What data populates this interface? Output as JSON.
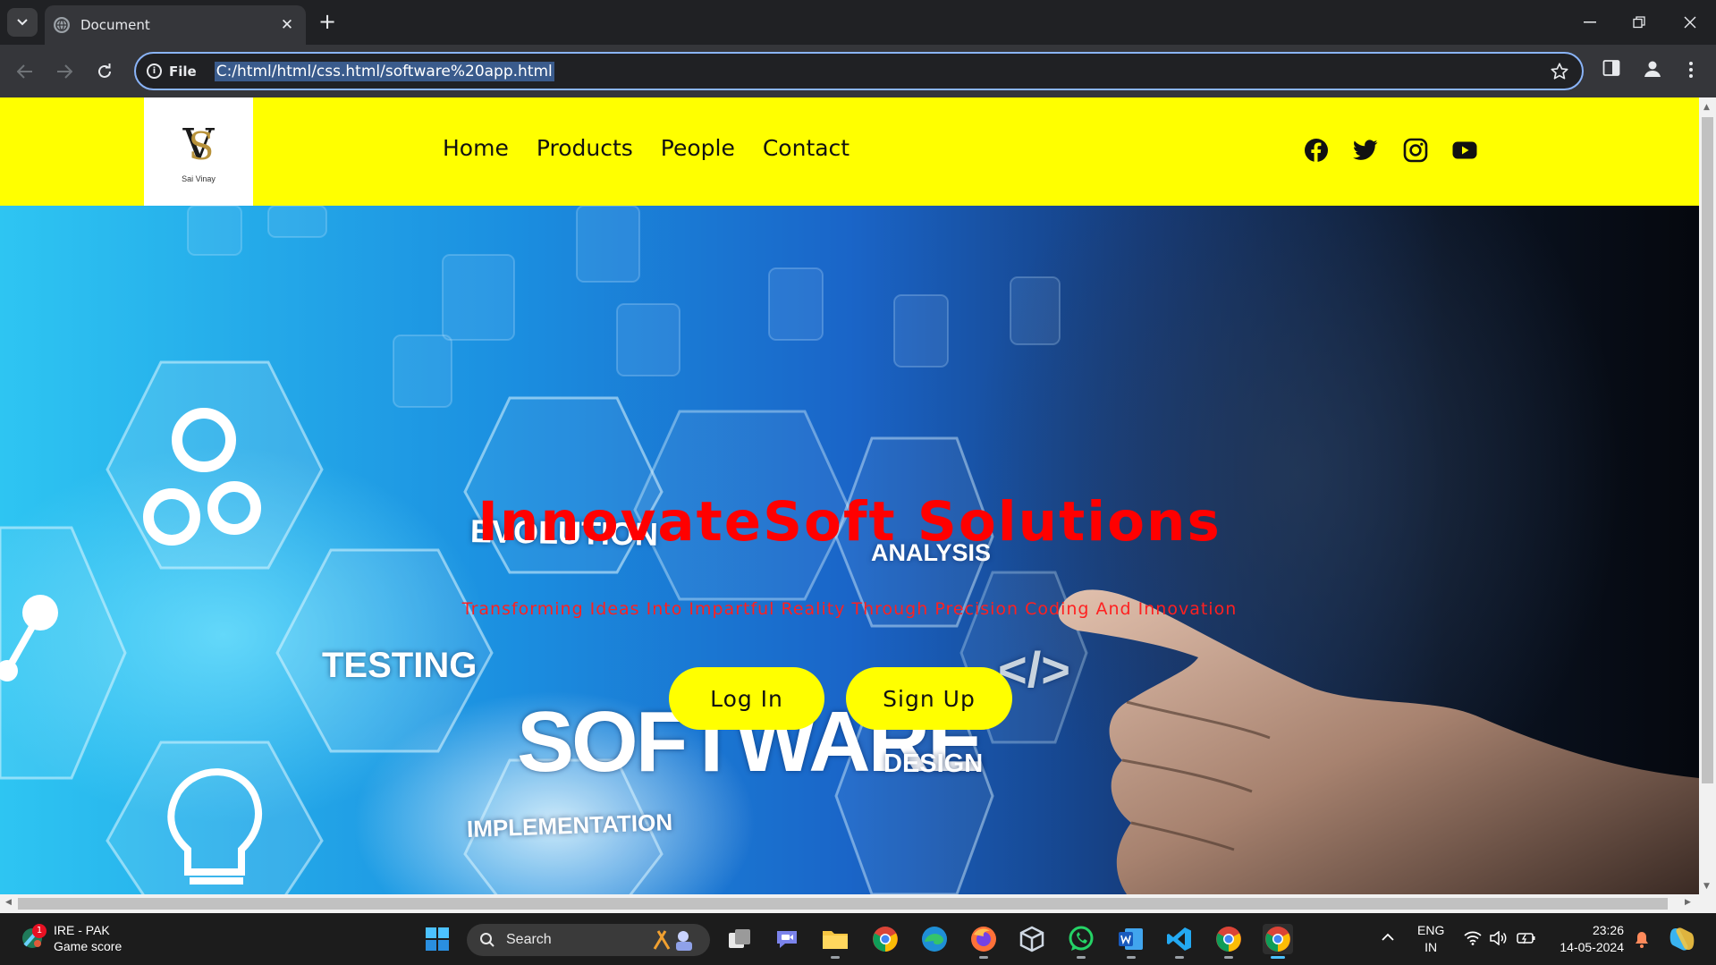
{
  "browser": {
    "tab_title": "Document",
    "url_scheme_label": "File",
    "url": "C:/html/html/css.html/software%20app.html"
  },
  "site": {
    "logo": {
      "text": "Sai Vinay"
    },
    "nav": [
      "Home",
      "Products",
      "People",
      "Contact"
    ],
    "social": [
      "facebook-icon",
      "twitter-icon",
      "instagram-icon",
      "youtube-icon"
    ],
    "hero": {
      "title": "InnovateSoft Solutions",
      "subtitle": "Transforming Ideas Into Impartful Reality Through Precision Coding And Innovation",
      "buttons": {
        "login": "Log In",
        "signup": "Sign Up"
      },
      "image_words": {
        "evolution": "EVOLUTION",
        "analysis": "ANALYSIS",
        "testing": "TESTING",
        "software": "SOFTWARE",
        "implementation": "IMPLEMENTATION",
        "design": "DESIGN",
        "code": "</>"
      }
    },
    "colors": {
      "header": "#ffff00",
      "title": "#ff0000",
      "button": "#ffff00"
    }
  },
  "taskbar": {
    "weather": {
      "badge": "1",
      "line1": "IRE - PAK",
      "line2": "Game score"
    },
    "search_placeholder": "Search",
    "tray": {
      "lang": "ENG",
      "region": "IN"
    },
    "clock": {
      "time": "23:26",
      "date": "14-05-2024"
    }
  }
}
